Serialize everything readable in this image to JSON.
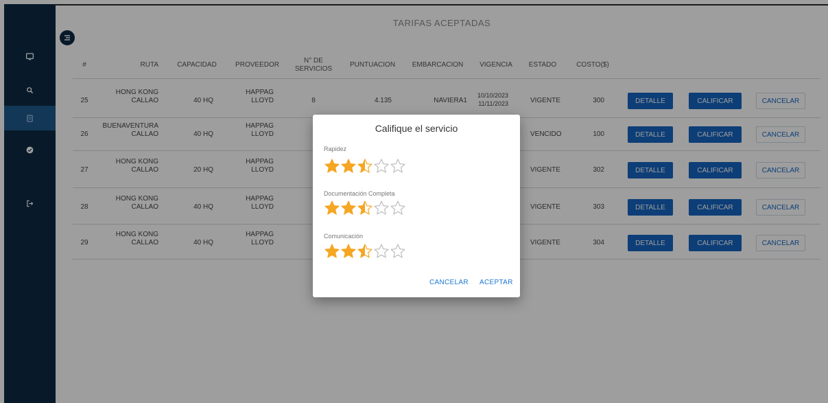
{
  "page": {
    "title": "TARIFAS ACEPTADAS"
  },
  "sidebar": {
    "items": [
      {
        "name": "monitor-icon"
      },
      {
        "name": "search-icon"
      },
      {
        "name": "document-icon"
      },
      {
        "name": "check-circle-icon"
      },
      {
        "name": "logout-icon"
      }
    ]
  },
  "table": {
    "headers": [
      "#",
      "RUTA",
      "CAPACIDAD",
      "PROVEEDOR",
      "N° DE",
      "SERVICIOS",
      "PUNTUACION",
      "EMBARCACION",
      "VIGENCIA",
      "ESTADO",
      "COSTO($)"
    ],
    "rows": [
      {
        "id": "25",
        "ruta1": "HONG KONG",
        "ruta2": "CALLAO",
        "capacidad": "40 HQ",
        "prov1": "HAPPAG",
        "prov2": "LLOYD",
        "servicios": "8",
        "puntuacion": "4.135",
        "embarcacion": "NAVIERA1",
        "vig1": "10/10/2023",
        "vig2": "11/11/2023",
        "estado": "VIGENTE",
        "costo": "300"
      },
      {
        "id": "26",
        "ruta1": "BUENAVENTURA",
        "ruta2": "CALLAO",
        "capacidad": "40 HQ",
        "prov1": "HAPPAG",
        "prov2": "LLOYD",
        "servicios": "",
        "puntuacion": "",
        "embarcacion": "",
        "vig1": "",
        "vig2": "",
        "estado": "VENCIDO",
        "costo": "100"
      },
      {
        "id": "27",
        "ruta1": "HONG KONG",
        "ruta2": "CALLAO",
        "capacidad": "20 HQ",
        "prov1": "HAPPAG",
        "prov2": "LLOYD",
        "servicios": "",
        "puntuacion": "",
        "embarcacion": "",
        "vig1": "",
        "vig2": "",
        "estado": "VIGENTE",
        "costo": "302"
      },
      {
        "id": "28",
        "ruta1": "HONG KONG",
        "ruta2": "CALLAO",
        "capacidad": "40 HQ",
        "prov1": "HAPPAG",
        "prov2": "LLOYD",
        "servicios": "",
        "puntuacion": "",
        "embarcacion": "",
        "vig1": "",
        "vig2": "",
        "estado": "VIGENTE",
        "costo": "303"
      },
      {
        "id": "29",
        "ruta1": "HONG KONG",
        "ruta2": "CALLAO",
        "capacidad": "40 HQ",
        "prov1": "HAPPAG",
        "prov2": "LLOYD",
        "servicios": "",
        "puntuacion": "",
        "embarcacion": "",
        "vig1": "",
        "vig2": "",
        "estado": "VIGENTE",
        "costo": "304"
      }
    ],
    "actions": {
      "detalle": "DETALLE",
      "calificar": "CALIFICAR",
      "cancelar": "CANCELAR"
    }
  },
  "dialog": {
    "title": "Califique el servicio",
    "criteria": [
      {
        "label": "Rapidez",
        "rating": 2.5,
        "max": 5
      },
      {
        "label": "Documentación Completa",
        "rating": 2.5,
        "max": 5
      },
      {
        "label": "Comunicación",
        "rating": 2.5,
        "max": 5
      }
    ],
    "cancel_label": "CANCELAR",
    "accept_label": "ACEPTAR"
  },
  "colors": {
    "sidebar": "#0d2a44",
    "primary": "#1565c0",
    "star": "#f5a623",
    "star_empty": "#bdbdbd"
  }
}
